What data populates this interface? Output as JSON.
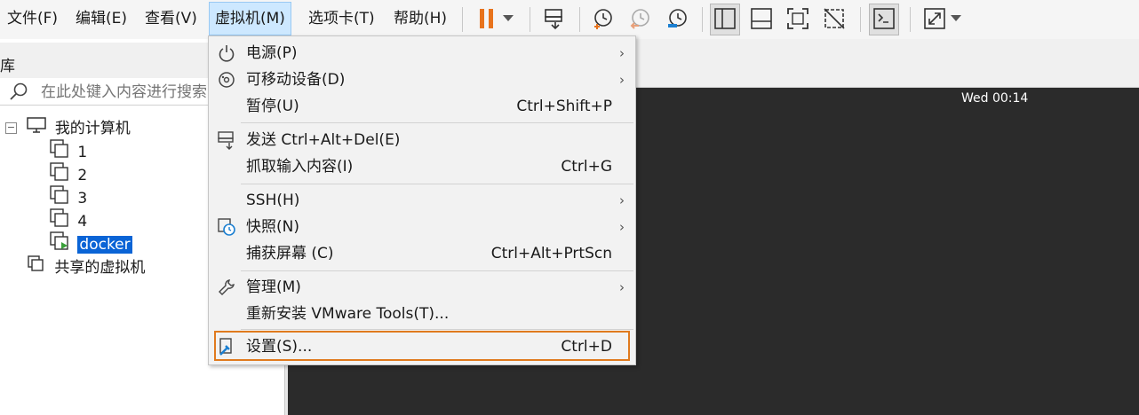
{
  "menubar": {
    "file": "文件(F)",
    "edit": "编辑(E)",
    "view": "查看(V)",
    "vm": "虚拟机(M)",
    "tabs": "选项卡(T)",
    "help": "帮助(H)"
  },
  "toolbar": {
    "icons": [
      "pause-icon",
      "dropdown-arrow-icon",
      "send-ctrl-alt-del-icon",
      "snapshot-take-icon",
      "snapshot-revert-icon",
      "snapshot-manager-icon",
      "library-view-icon",
      "thumbnail-bar-icon",
      "fullscreen-icon",
      "unity-icon",
      "console-view-icon",
      "stretch-view-icon"
    ],
    "pause_color": "#e8731c"
  },
  "library": {
    "title": "库",
    "search_placeholder": "在此处键入内容进行搜索",
    "root": "我的计算机",
    "vms": [
      "1",
      "2",
      "3",
      "4",
      "docker"
    ],
    "selected": "docker",
    "shared": "共享的虚拟机"
  },
  "vm_screen": {
    "clock": "Wed 00:14"
  },
  "vm_menu": {
    "items": [
      {
        "label": "电源(P)",
        "shortcut": "",
        "submenu": true,
        "icon": "power-icon"
      },
      {
        "label": "可移动设备(D)",
        "shortcut": "",
        "submenu": true,
        "icon": "removable-device-icon"
      },
      {
        "label": "暂停(U)",
        "shortcut": "Ctrl+Shift+P",
        "submenu": false,
        "icon": ""
      },
      {
        "label": "发送 Ctrl+Alt+Del(E)",
        "shortcut": "",
        "submenu": false,
        "icon": "send-keys-icon"
      },
      {
        "label": "抓取输入内容(I)",
        "shortcut": "Ctrl+G",
        "submenu": false,
        "icon": ""
      },
      {
        "label": "SSH(H)",
        "shortcut": "",
        "submenu": true,
        "icon": ""
      },
      {
        "label": "快照(N)",
        "shortcut": "",
        "submenu": true,
        "icon": "snapshot-icon"
      },
      {
        "label": "捕获屏幕 (C)",
        "shortcut": "Ctrl+Alt+PrtScn",
        "submenu": false,
        "icon": ""
      },
      {
        "label": "管理(M)",
        "shortcut": "",
        "submenu": true,
        "icon": "wrench-icon"
      },
      {
        "label": "重新安装 VMware Tools(T)...",
        "shortcut": "",
        "submenu": false,
        "icon": ""
      },
      {
        "label": "设置(S)...",
        "shortcut": "Ctrl+D",
        "submenu": false,
        "icon": "settings-icon"
      }
    ],
    "highlight_color": "#e07a1e"
  }
}
